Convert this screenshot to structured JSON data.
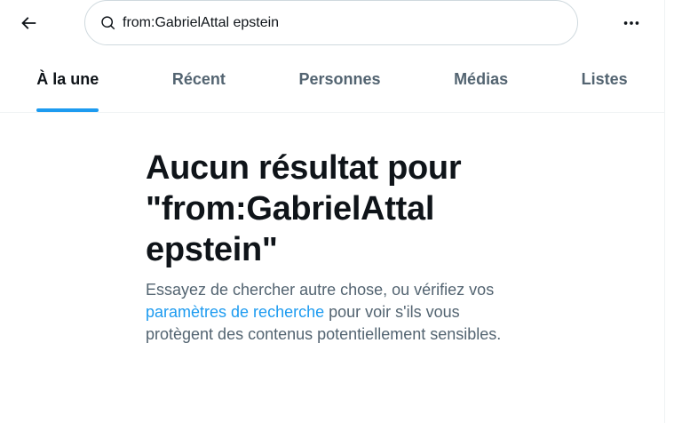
{
  "header": {
    "search_value": "from:GabrielAttal epstein",
    "back_icon": "arrow-left-icon",
    "more_icon": "more-horizontal-icon",
    "search_icon": "search-icon"
  },
  "tabs": [
    {
      "label": "À la une",
      "active": true
    },
    {
      "label": "Récent",
      "active": false
    },
    {
      "label": "Personnes",
      "active": false
    },
    {
      "label": "Médias",
      "active": false
    },
    {
      "label": "Listes",
      "active": false
    }
  ],
  "empty_state": {
    "title": "Aucun résultat pour \"from:GabrielAttal epstein\"",
    "body_before": "Essayez de chercher autre chose, ou vérifiez vos ",
    "link_text": "paramètres de recherche",
    "body_after": " pour voir s'ils vous protègent des contenus potentiellement sensibles."
  },
  "colors": {
    "accent": "#1d9bf0",
    "text_primary": "#0f1419",
    "text_secondary": "#536471",
    "border": "#eff3f4"
  }
}
